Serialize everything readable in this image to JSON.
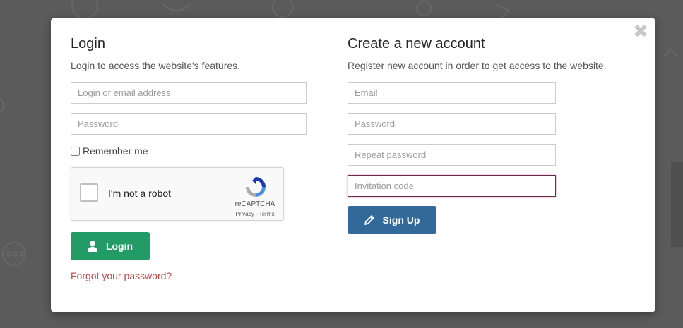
{
  "colors": {
    "backdrop": "#5b5b5b",
    "login_button": "#239b66",
    "signup_button": "#33689b",
    "link": "#b94a48",
    "focus_border": "#6b2b4f"
  },
  "login": {
    "title": "Login",
    "subtitle": "Login to access the website's features.",
    "login_placeholder": "Login or email address",
    "password_placeholder": "Password",
    "remember_label": "Remember me",
    "remember_checked": false,
    "button_label": "Login",
    "button_icon": "user-icon",
    "forgot_link": "Forgot your password?"
  },
  "recaptcha": {
    "label": "I'm not a robot",
    "brand": "reCAPTCHA",
    "links": "Privacy - Terms",
    "checked": false
  },
  "register": {
    "title": "Create a new account",
    "subtitle": "Register new account in order to get access to the website.",
    "email_placeholder": "Email",
    "password_placeholder": "Password",
    "repeat_placeholder": "Repeat password",
    "invitation_placeholder": "Invitation code",
    "button_label": "Sign Up",
    "button_icon": "pencil-icon"
  },
  "close_icon": "close-icon"
}
